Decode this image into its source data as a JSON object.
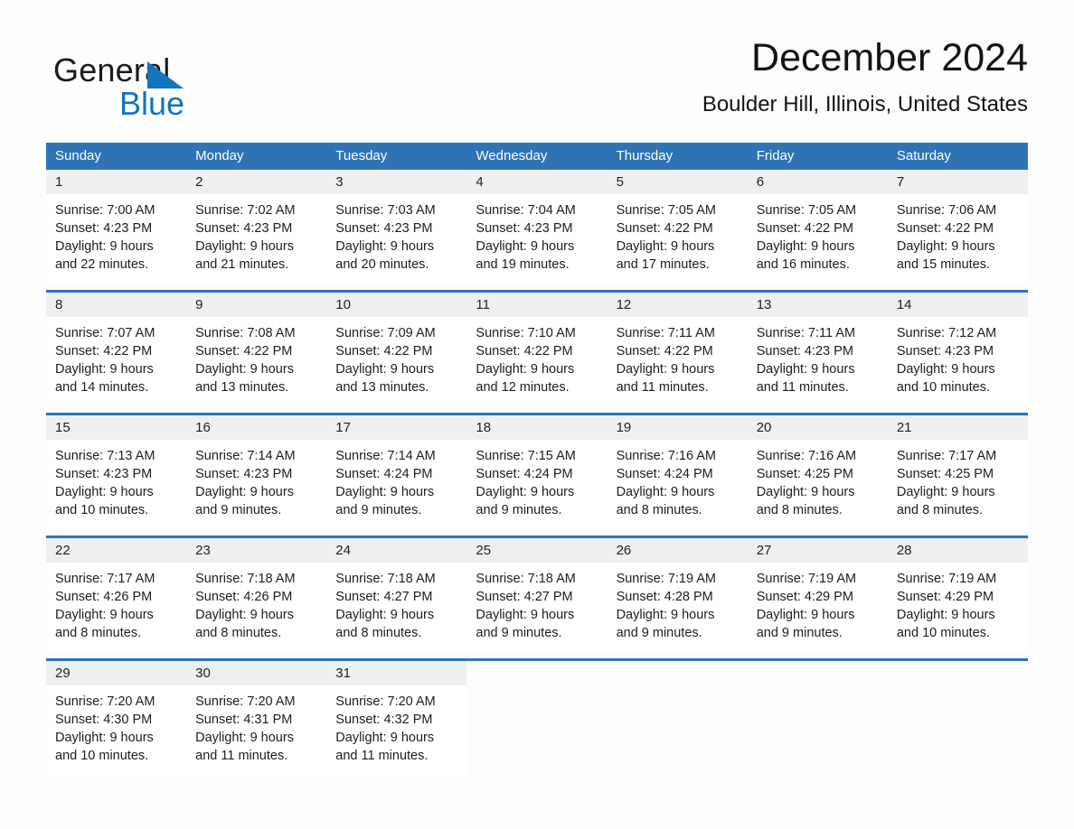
{
  "brand": {
    "name_part1": "General",
    "name_part2": "Blue",
    "accent_color": "#1474bc"
  },
  "header": {
    "title": "December 2024",
    "subtitle": "Boulder Hill, Illinois, United States"
  },
  "theme": {
    "header_blue": "#2e74b5",
    "daynum_background": "#efefef",
    "page_background": "#fdfdfd"
  },
  "calendar": {
    "weekdays": [
      "Sunday",
      "Monday",
      "Tuesday",
      "Wednesday",
      "Thursday",
      "Friday",
      "Saturday"
    ],
    "weeks": [
      {
        "days": [
          {
            "date": "1",
            "sunrise": "Sunrise: 7:00 AM",
            "sunset": "Sunset: 4:23 PM",
            "daylight_line1": "Daylight: 9 hours",
            "daylight_line2": "and 22 minutes."
          },
          {
            "date": "2",
            "sunrise": "Sunrise: 7:02 AM",
            "sunset": "Sunset: 4:23 PM",
            "daylight_line1": "Daylight: 9 hours",
            "daylight_line2": "and 21 minutes."
          },
          {
            "date": "3",
            "sunrise": "Sunrise: 7:03 AM",
            "sunset": "Sunset: 4:23 PM",
            "daylight_line1": "Daylight: 9 hours",
            "daylight_line2": "and 20 minutes."
          },
          {
            "date": "4",
            "sunrise": "Sunrise: 7:04 AM",
            "sunset": "Sunset: 4:23 PM",
            "daylight_line1": "Daylight: 9 hours",
            "daylight_line2": "and 19 minutes."
          },
          {
            "date": "5",
            "sunrise": "Sunrise: 7:05 AM",
            "sunset": "Sunset: 4:22 PM",
            "daylight_line1": "Daylight: 9 hours",
            "daylight_line2": "and 17 minutes."
          },
          {
            "date": "6",
            "sunrise": "Sunrise: 7:05 AM",
            "sunset": "Sunset: 4:22 PM",
            "daylight_line1": "Daylight: 9 hours",
            "daylight_line2": "and 16 minutes."
          },
          {
            "date": "7",
            "sunrise": "Sunrise: 7:06 AM",
            "sunset": "Sunset: 4:22 PM",
            "daylight_line1": "Daylight: 9 hours",
            "daylight_line2": "and 15 minutes."
          }
        ]
      },
      {
        "days": [
          {
            "date": "8",
            "sunrise": "Sunrise: 7:07 AM",
            "sunset": "Sunset: 4:22 PM",
            "daylight_line1": "Daylight: 9 hours",
            "daylight_line2": "and 14 minutes."
          },
          {
            "date": "9",
            "sunrise": "Sunrise: 7:08 AM",
            "sunset": "Sunset: 4:22 PM",
            "daylight_line1": "Daylight: 9 hours",
            "daylight_line2": "and 13 minutes."
          },
          {
            "date": "10",
            "sunrise": "Sunrise: 7:09 AM",
            "sunset": "Sunset: 4:22 PM",
            "daylight_line1": "Daylight: 9 hours",
            "daylight_line2": "and 13 minutes."
          },
          {
            "date": "11",
            "sunrise": "Sunrise: 7:10 AM",
            "sunset": "Sunset: 4:22 PM",
            "daylight_line1": "Daylight: 9 hours",
            "daylight_line2": "and 12 minutes."
          },
          {
            "date": "12",
            "sunrise": "Sunrise: 7:11 AM",
            "sunset": "Sunset: 4:22 PM",
            "daylight_line1": "Daylight: 9 hours",
            "daylight_line2": "and 11 minutes."
          },
          {
            "date": "13",
            "sunrise": "Sunrise: 7:11 AM",
            "sunset": "Sunset: 4:23 PM",
            "daylight_line1": "Daylight: 9 hours",
            "daylight_line2": "and 11 minutes."
          },
          {
            "date": "14",
            "sunrise": "Sunrise: 7:12 AM",
            "sunset": "Sunset: 4:23 PM",
            "daylight_line1": "Daylight: 9 hours",
            "daylight_line2": "and 10 minutes."
          }
        ]
      },
      {
        "days": [
          {
            "date": "15",
            "sunrise": "Sunrise: 7:13 AM",
            "sunset": "Sunset: 4:23 PM",
            "daylight_line1": "Daylight: 9 hours",
            "daylight_line2": "and 10 minutes."
          },
          {
            "date": "16",
            "sunrise": "Sunrise: 7:14 AM",
            "sunset": "Sunset: 4:23 PM",
            "daylight_line1": "Daylight: 9 hours",
            "daylight_line2": "and 9 minutes."
          },
          {
            "date": "17",
            "sunrise": "Sunrise: 7:14 AM",
            "sunset": "Sunset: 4:24 PM",
            "daylight_line1": "Daylight: 9 hours",
            "daylight_line2": "and 9 minutes."
          },
          {
            "date": "18",
            "sunrise": "Sunrise: 7:15 AM",
            "sunset": "Sunset: 4:24 PM",
            "daylight_line1": "Daylight: 9 hours",
            "daylight_line2": "and 9 minutes."
          },
          {
            "date": "19",
            "sunrise": "Sunrise: 7:16 AM",
            "sunset": "Sunset: 4:24 PM",
            "daylight_line1": "Daylight: 9 hours",
            "daylight_line2": "and 8 minutes."
          },
          {
            "date": "20",
            "sunrise": "Sunrise: 7:16 AM",
            "sunset": "Sunset: 4:25 PM",
            "daylight_line1": "Daylight: 9 hours",
            "daylight_line2": "and 8 minutes."
          },
          {
            "date": "21",
            "sunrise": "Sunrise: 7:17 AM",
            "sunset": "Sunset: 4:25 PM",
            "daylight_line1": "Daylight: 9 hours",
            "daylight_line2": "and 8 minutes."
          }
        ]
      },
      {
        "days": [
          {
            "date": "22",
            "sunrise": "Sunrise: 7:17 AM",
            "sunset": "Sunset: 4:26 PM",
            "daylight_line1": "Daylight: 9 hours",
            "daylight_line2": "and 8 minutes."
          },
          {
            "date": "23",
            "sunrise": "Sunrise: 7:18 AM",
            "sunset": "Sunset: 4:26 PM",
            "daylight_line1": "Daylight: 9 hours",
            "daylight_line2": "and 8 minutes."
          },
          {
            "date": "24",
            "sunrise": "Sunrise: 7:18 AM",
            "sunset": "Sunset: 4:27 PM",
            "daylight_line1": "Daylight: 9 hours",
            "daylight_line2": "and 8 minutes."
          },
          {
            "date": "25",
            "sunrise": "Sunrise: 7:18 AM",
            "sunset": "Sunset: 4:27 PM",
            "daylight_line1": "Daylight: 9 hours",
            "daylight_line2": "and 9 minutes."
          },
          {
            "date": "26",
            "sunrise": "Sunrise: 7:19 AM",
            "sunset": "Sunset: 4:28 PM",
            "daylight_line1": "Daylight: 9 hours",
            "daylight_line2": "and 9 minutes."
          },
          {
            "date": "27",
            "sunrise": "Sunrise: 7:19 AM",
            "sunset": "Sunset: 4:29 PM",
            "daylight_line1": "Daylight: 9 hours",
            "daylight_line2": "and 9 minutes."
          },
          {
            "date": "28",
            "sunrise": "Sunrise: 7:19 AM",
            "sunset": "Sunset: 4:29 PM",
            "daylight_line1": "Daylight: 9 hours",
            "daylight_line2": "and 10 minutes."
          }
        ]
      },
      {
        "days": [
          {
            "date": "29",
            "sunrise": "Sunrise: 7:20 AM",
            "sunset": "Sunset: 4:30 PM",
            "daylight_line1": "Daylight: 9 hours",
            "daylight_line2": "and 10 minutes."
          },
          {
            "date": "30",
            "sunrise": "Sunrise: 7:20 AM",
            "sunset": "Sunset: 4:31 PM",
            "daylight_line1": "Daylight: 9 hours",
            "daylight_line2": "and 11 minutes."
          },
          {
            "date": "31",
            "sunrise": "Sunrise: 7:20 AM",
            "sunset": "Sunset: 4:32 PM",
            "daylight_line1": "Daylight: 9 hours",
            "daylight_line2": "and 11 minutes."
          },
          {
            "date": "",
            "sunrise": "",
            "sunset": "",
            "daylight_line1": "",
            "daylight_line2": ""
          },
          {
            "date": "",
            "sunrise": "",
            "sunset": "",
            "daylight_line1": "",
            "daylight_line2": ""
          },
          {
            "date": "",
            "sunrise": "",
            "sunset": "",
            "daylight_line1": "",
            "daylight_line2": ""
          },
          {
            "date": "",
            "sunrise": "",
            "sunset": "",
            "daylight_line1": "",
            "daylight_line2": ""
          }
        ]
      }
    ]
  }
}
